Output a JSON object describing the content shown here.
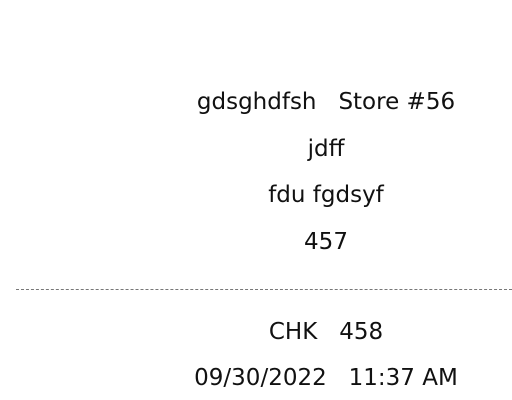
{
  "store": {
    "name_line": "gdsghdfsh   Store #56",
    "address_line1": "jdff",
    "address_line2": "fdu fgdsyf",
    "address_line3": "457"
  },
  "transaction": {
    "check_line": "CHK   458",
    "datetime_line": "09/30/2022   11:37 AM"
  }
}
